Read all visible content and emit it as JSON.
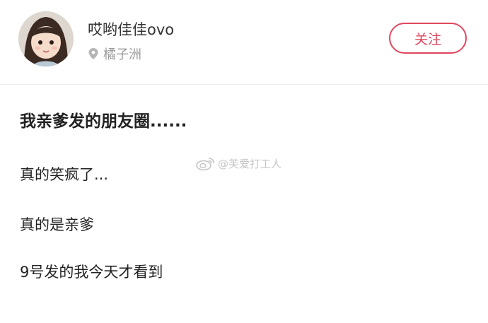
{
  "profile": {
    "username": "哎哟佳佳ovo",
    "location": "橘子洲",
    "location_icon": "location-pin-icon",
    "follow_label": "关注"
  },
  "post": {
    "title": "我亲爹发的朋友圈......",
    "lines": [
      "真的笑疯了...",
      "真的是亲爹",
      "9号发的我今天才看到"
    ]
  },
  "watermark": {
    "text": "@芙爱打工人",
    "icon": "weibo-logo-icon"
  },
  "colors": {
    "accent": "#e0475e",
    "secondary_text": "#9a9a9a",
    "primary_text": "#222222",
    "divider": "#eeeeee"
  }
}
